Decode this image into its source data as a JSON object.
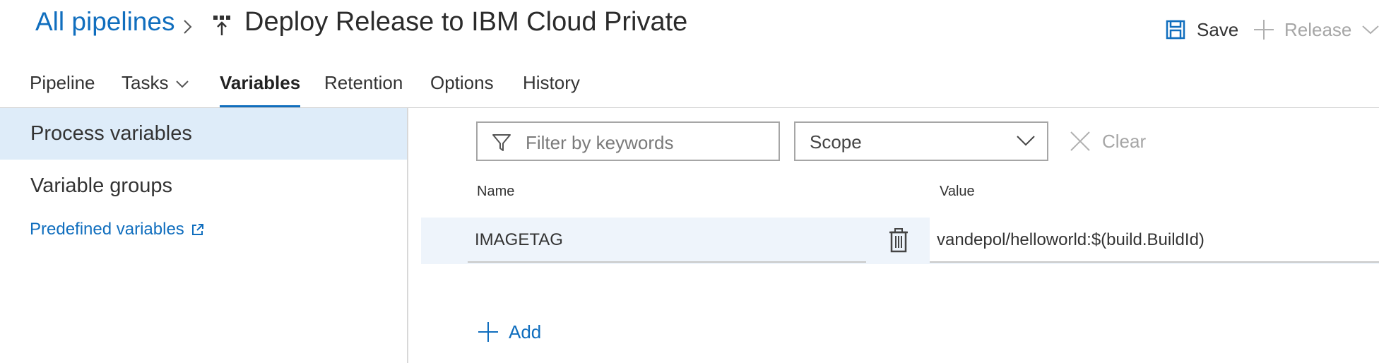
{
  "header": {
    "breadcrumb_root": "All pipelines",
    "title": "Deploy Release to IBM Cloud Private",
    "save_label": "Save",
    "release_label": "Release"
  },
  "tabs": [
    {
      "label": "Pipeline"
    },
    {
      "label": "Tasks"
    },
    {
      "label": "Variables",
      "active": true
    },
    {
      "label": "Retention"
    },
    {
      "label": "Options"
    },
    {
      "label": "History"
    }
  ],
  "sidebar": {
    "items": [
      {
        "label": "Process variables",
        "selected": true
      },
      {
        "label": "Variable groups"
      }
    ],
    "predefined_link": "Predefined variables"
  },
  "filter": {
    "placeholder": "Filter by keywords",
    "value": "",
    "scope_label": "Scope",
    "clear_label": "Clear"
  },
  "grid": {
    "columns": {
      "name": "Name",
      "value": "Value"
    },
    "rows": [
      {
        "name": "IMAGETAG",
        "value": "vandepol/helloworld:$(build.BuildId)"
      }
    ],
    "add_label": "Add"
  },
  "colors": {
    "accent": "#106ebe",
    "selected_bg": "#deecf9",
    "row_bg": "#eef4fb",
    "disabled_text": "#a6a6a6"
  },
  "icons": {
    "breadcrumb_separator": "chevron-right-icon",
    "pipeline": "release-pipeline-icon",
    "save": "save-icon",
    "release": "plus-icon",
    "release_menu": "chevron-down-icon",
    "filter": "filter-icon",
    "scope": "chevron-down-icon",
    "clear": "close-icon",
    "delete": "trash-icon",
    "add": "plus-icon",
    "external_link": "external-link-icon"
  }
}
